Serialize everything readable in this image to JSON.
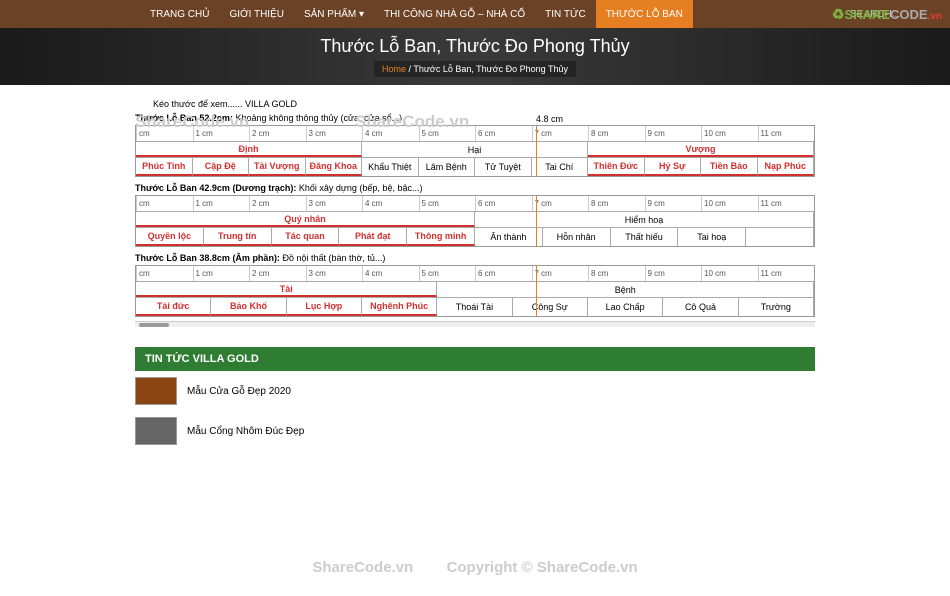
{
  "nav": {
    "items": [
      "TRANG CHỦ",
      "GIỚI THIỆU",
      "SẢN PHẨM",
      "THI CÔNG NHÀ GỖ – NHÀ CỔ",
      "TIN TỨC",
      "THƯỚC LỖ BAN"
    ],
    "active": 5,
    "search_placeholder": "SEARCH..."
  },
  "logo_text": "SHARECODE.vn",
  "hero": {
    "title": "Thước Lỗ Ban, Thước Đo Phong Thủy",
    "home": "Home",
    "sep": "/",
    "page": "Thước Lỗ Ban, Thước Đo Phong Thủy"
  },
  "watermarks": [
    "ShareCode.vn",
    "ShareCode.vn",
    "ShareCode.vn",
    "Copyright © ShareCode.vn"
  ],
  "instruction": "Kéo thước để xem...... VILLA GOLD",
  "indicator_cm": "4.8 cm",
  "rulers": [
    {
      "label_bold": "Thước Lỗ Ban 52.2cm:",
      "label_rest": " Khoảng không thông thủy (cửa, cửa sổ...)",
      "ticks": [
        "cm",
        "1 cm",
        "2 cm",
        "3 cm",
        "4 cm",
        "5 cm",
        "6 cm",
        "7 cm",
        "8 cm",
        "9 cm",
        "10 cm",
        "11 cm"
      ],
      "groups": [
        {
          "label": "Định",
          "red": true,
          "span": 4
        },
        {
          "label": "Hại",
          "red": false,
          "span": 4
        },
        {
          "label": "Vượng",
          "red": true,
          "span": 4
        }
      ],
      "cells": [
        {
          "t": "Phúc Tinh",
          "r": true
        },
        {
          "t": "Cập Đệ",
          "r": true
        },
        {
          "t": "Tài Vượng",
          "r": true
        },
        {
          "t": "Đăng Khoa",
          "r": true
        },
        {
          "t": "Khẩu Thiệt",
          "r": false
        },
        {
          "t": "Lâm Bệnh",
          "r": false
        },
        {
          "t": "Tử Tuyệt",
          "r": false
        },
        {
          "t": "Tai Chí",
          "r": false
        },
        {
          "t": "Thiên Đức",
          "r": true
        },
        {
          "t": "Hỷ Sự",
          "r": true
        },
        {
          "t": "Tiền Bảo",
          "r": true
        },
        {
          "t": "Nạp Phúc",
          "r": true
        }
      ]
    },
    {
      "label_bold": "Thước Lỗ Ban 42.9cm (Dương trạch):",
      "label_rest": " Khối xây dựng (bếp, bệ, bậc...)",
      "ticks": [
        "cm",
        "1 cm",
        "2 cm",
        "3 cm",
        "4 cm",
        "5 cm",
        "6 cm",
        "7 cm",
        "8 cm",
        "9 cm",
        "10 cm",
        "11 cm"
      ],
      "groups": [
        {
          "label": "Quý nhân",
          "red": true,
          "span": 5
        },
        {
          "label": "Hiểm hoạ",
          "red": false,
          "span": 5
        }
      ],
      "cells": [
        {
          "t": "Quyền lộc",
          "r": true
        },
        {
          "t": "Trung tín",
          "r": true
        },
        {
          "t": "Tác quan",
          "r": true
        },
        {
          "t": "Phát đạt",
          "r": true
        },
        {
          "t": "Thông minh",
          "r": true
        },
        {
          "t": "Ân thành",
          "r": false
        },
        {
          "t": "Hỗn nhân",
          "r": false
        },
        {
          "t": "Thất hiếu",
          "r": false
        },
        {
          "t": "Tai hoạ",
          "r": false
        },
        {
          "t": "",
          "r": false
        }
      ]
    },
    {
      "label_bold": "Thước Lỗ Ban 38.8cm (Âm phần):",
      "label_rest": " Đồ nội thất (bàn thờ, tủ...)",
      "ticks": [
        "cm",
        "1 cm",
        "2 cm",
        "3 cm",
        "4 cm",
        "5 cm",
        "6 cm",
        "7 cm",
        "8 cm",
        "9 cm",
        "10 cm",
        "11 cm"
      ],
      "groups": [
        {
          "label": "Tài",
          "red": true,
          "span": 4
        },
        {
          "label": "Bệnh",
          "red": false,
          "span": 5
        }
      ],
      "cells": [
        {
          "t": "Tài đức",
          "r": true
        },
        {
          "t": "Bảo Khố",
          "r": true
        },
        {
          "t": "Lục Hợp",
          "r": true
        },
        {
          "t": "Nghênh Phúc",
          "r": true
        },
        {
          "t": "Thoái Tài",
          "r": false
        },
        {
          "t": "Công Sự",
          "r": false
        },
        {
          "t": "Lao Chấp",
          "r": false
        },
        {
          "t": "Cô Quả",
          "r": false
        },
        {
          "t": "Trường",
          "r": false
        }
      ]
    }
  ],
  "news": {
    "heading": "TIN TỨC VILLA GOLD",
    "items": [
      "Mẫu Cửa Gỗ Đẹp 2020",
      "Mẫu Cổng Nhôm Đúc Đẹp"
    ]
  }
}
